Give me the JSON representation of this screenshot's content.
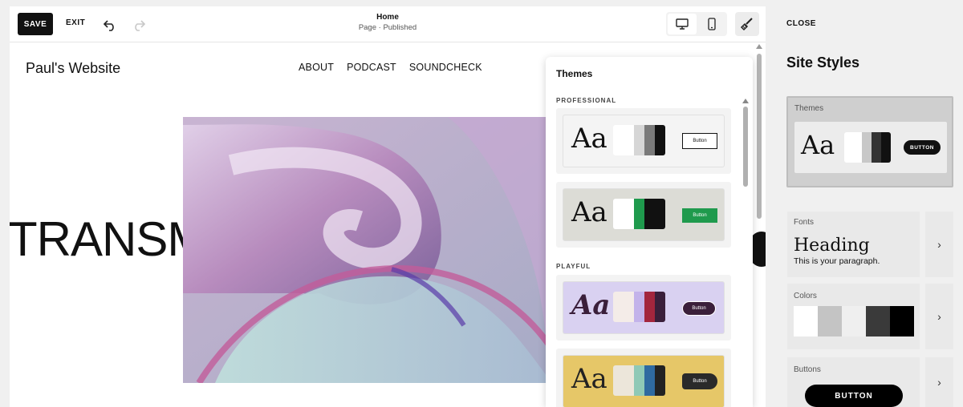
{
  "toolbar": {
    "save_label": "SAVE",
    "exit_label": "EXIT",
    "page_title": "Home",
    "page_status": "Page · Published"
  },
  "site": {
    "name": "Paul's Website",
    "nav": [
      "ABOUT",
      "PODCAST",
      "SOUNDCHECK"
    ],
    "hero_text": "TRANSM"
  },
  "themes_panel": {
    "title": "Themes",
    "sections": [
      {
        "label": "PROFESSIONAL"
      },
      {
        "label": "PLAYFUL"
      }
    ],
    "themes": [
      {
        "aa": "Aa",
        "button_label": "Button",
        "bg": "#f4f4f4",
        "text_color": "#111111",
        "swatches": [
          "#ffffff",
          "#d6d6d6",
          "#7a7a7a",
          "#111111"
        ],
        "button_bg": "#ffffff",
        "button_fg": "#111111",
        "button_border": "#111111"
      },
      {
        "aa": "Aa",
        "button_label": "Button",
        "bg": "#dcdcd6",
        "text_color": "#111111",
        "swatches": [
          "#ffffff",
          "#1f9a4d",
          "#111111",
          "#111111"
        ],
        "button_bg": "#1f9a4d",
        "button_fg": "#ffffff",
        "button_border": "#1f9a4d"
      },
      {
        "aa": "Aa",
        "button_label": "Button",
        "bg": "#d9d1f1",
        "text_color": "#3a1f3a",
        "swatches": [
          "#f4ece8",
          "#c3b3ea",
          "#a3263d",
          "#3a1f3a"
        ],
        "button_bg": "#3a1f3a",
        "button_fg": "#ffffff",
        "button_border": "#ffffff"
      },
      {
        "aa": "Aa",
        "button_label": "Button",
        "bg": "#e6c768",
        "text_color": "#222222",
        "swatches": [
          "#ece6da",
          "#8fc9b6",
          "#2f6aa0",
          "#222222"
        ],
        "button_bg": "#2a2a2a",
        "button_fg": "#ffffff",
        "button_border": "#2a2a2a"
      }
    ]
  },
  "sidebar": {
    "close_label": "CLOSE",
    "title": "Site Styles",
    "themes": {
      "label": "Themes",
      "aa": "Aa",
      "button_label": "BUTTON",
      "swatches": [
        "#ffffff",
        "#c8c8c8",
        "#333333",
        "#111111"
      ]
    },
    "fonts": {
      "label": "Fonts",
      "heading": "Heading",
      "paragraph": "This is your paragraph."
    },
    "colors": {
      "label": "Colors",
      "swatches": [
        "#ffffff",
        "#c4c4c4",
        "#efefef",
        "#3a3a3a",
        "#000000"
      ]
    },
    "buttons": {
      "label": "Buttons",
      "button_label": "BUTTON"
    }
  }
}
